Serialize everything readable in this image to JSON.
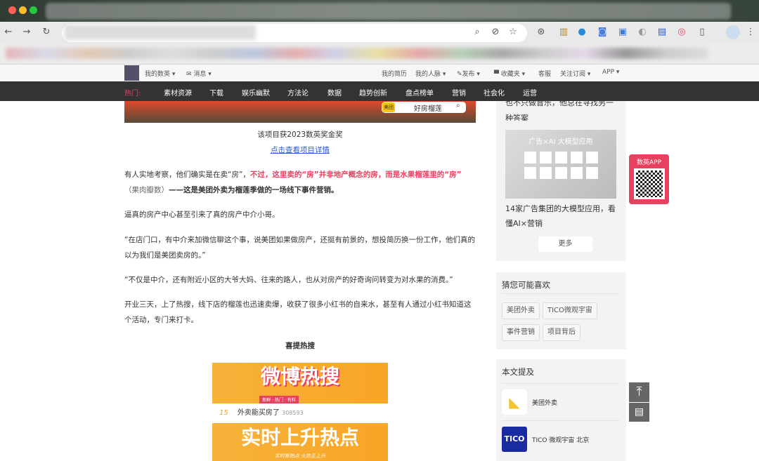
{
  "site_header": {
    "my_account": "我的数英",
    "messages": "消息",
    "resume": "我的简历",
    "network": "我的人脉",
    "publish": "发布",
    "favorites": "收藏夹",
    "service": "客服",
    "subscribe": "关注订阅",
    "app": "APP"
  },
  "nav": {
    "hot_label": "热门:",
    "items": [
      "素材资源",
      "下载",
      "娱乐幽默",
      "方法论",
      "数据",
      "趋势创新",
      "盘点榜单",
      "营销",
      "社会化",
      "运营"
    ]
  },
  "banner": {
    "brand": "美团",
    "search_text": "好房榴莲"
  },
  "article": {
    "award": "该项目获2023数英奖金奖",
    "detail_link": "点击查看项目详情",
    "p1_a": "有人实地考察，他们确实是在卖“房”，",
    "p1_b": "不过，这里卖的“房”并非地产概念的房，而是水果榴莲里的“房”",
    "p1_c": "（果肉瓣数）",
    "p1_d": "——这是美团外卖为榴莲季做的一场线下事件营销。",
    "p2": "逼真的房产中心甚至引来了真的房产中介小哥。",
    "p3": "“在店门口，有中介来加微信聊这个事，说美团如果做房产，还挺有前景的，想投简历换一份工作，他们真的以为我们是美团卖房的。”",
    "p4": "“不仅是中介，还有附近小区的大爷大妈、往来的路人，也从对房产的好奇询问转变为对水果的消费。”",
    "p5": "开业三天，上了热搜，线下店的榴莲也迅速卖爆，收获了很多小红书的自来水，甚至有人通过小红书知道这个活动，专门来打卡。",
    "hot_heading": "喜提热搜",
    "weibo_title": "微博热搜",
    "weibo_sub": "新鲜 · 热门 · 有料",
    "hot_rank": "15",
    "hot_topic": "外卖能买房了",
    "hot_count": "308593",
    "rising_title": "实时上升热点",
    "rising_sub": "实时新热点 火热正上升"
  },
  "sidebar": {
    "prev_text": "也不只做音乐，他总在寻找另一种答案",
    "ad_image_title": "广告×AI 大模型应用",
    "ad_caption": "14家广告集团的大模型应用，看懂AI×营销",
    "more": "更多",
    "guess_title": "猜您可能喜欢",
    "tags": [
      "美团外卖",
      "TICO微观宇宙",
      "事件营销",
      "项目背后"
    ],
    "mention_title": "本文提及",
    "mentions": [
      {
        "name": "美团外卖"
      },
      {
        "name": "TICO 微观宇宙 北京",
        "logo": "TICO"
      }
    ]
  },
  "float": {
    "app_label": "数英APP"
  },
  "colors": {
    "accent": "#e8415f",
    "nav_bg": "#333333",
    "link": "#2a5bd7"
  }
}
